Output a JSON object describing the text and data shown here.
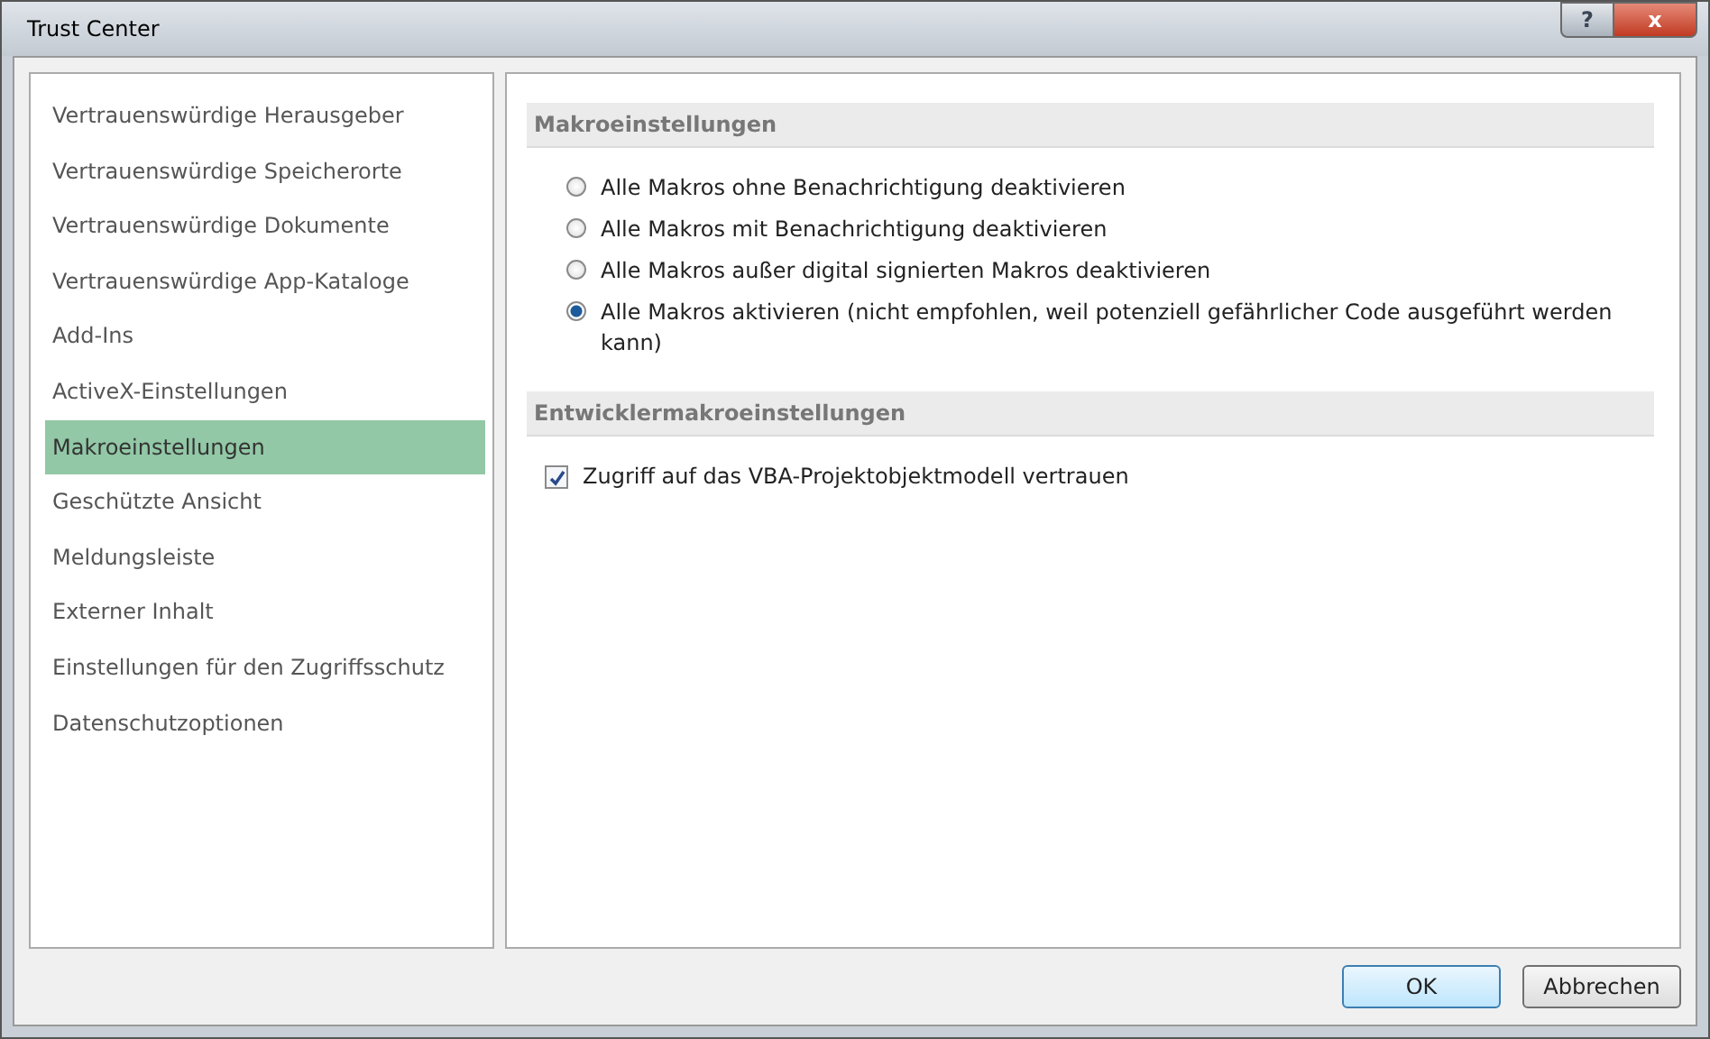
{
  "window": {
    "title": "Trust Center"
  },
  "title_buttons": [
    {
      "kind": "help",
      "label": "?"
    },
    {
      "kind": "close",
      "label": "x"
    }
  ],
  "sidebar": {
    "items": [
      {
        "label": "Vertrauenswürdige Herausgeber",
        "selected": false
      },
      {
        "label": "Vertrauenswürdige Speicherorte",
        "selected": false
      },
      {
        "label": "Vertrauenswürdige Dokumente",
        "selected": false
      },
      {
        "label": "Vertrauenswürdige App-Kataloge",
        "selected": false
      },
      {
        "label": "Add-Ins",
        "selected": false
      },
      {
        "label": "ActiveX-Einstellungen",
        "selected": false
      },
      {
        "label": "Makroeinstellungen",
        "selected": true
      },
      {
        "label": "Geschützte Ansicht",
        "selected": false
      },
      {
        "label": "Meldungsleiste",
        "selected": false
      },
      {
        "label": "Externer Inhalt",
        "selected": false
      },
      {
        "label": "Einstellungen für den Zugriffsschutz",
        "selected": false
      },
      {
        "label": "Datenschutzoptionen",
        "selected": false
      }
    ]
  },
  "sections": [
    {
      "title": "Makroeinstellungen",
      "options": [
        {
          "kind": "radio",
          "label": "Alle Makros ohne Benachrichtigung deaktivieren",
          "selected": false
        },
        {
          "kind": "radio",
          "label": "Alle Makros mit Benachrichtigung deaktivieren",
          "selected": false
        },
        {
          "kind": "radio",
          "label": "Alle Makros außer digital signierten Makros deaktivieren",
          "selected": false
        },
        {
          "kind": "radio",
          "label": "Alle Makros aktivieren (nicht empfohlen, weil potenziell gefährlicher Code ausgeführt werden kann)",
          "selected": true
        }
      ]
    },
    {
      "title": "Entwicklermakroeinstellungen",
      "options": [
        {
          "kind": "checkbox",
          "label": "Zugriff auf das VBA-Projektobjektmodell vertrauen",
          "checked": true
        }
      ]
    }
  ],
  "buttons": [
    {
      "label": "OK",
      "default": true
    },
    {
      "label": "Abbrechen",
      "default": false
    }
  ]
}
